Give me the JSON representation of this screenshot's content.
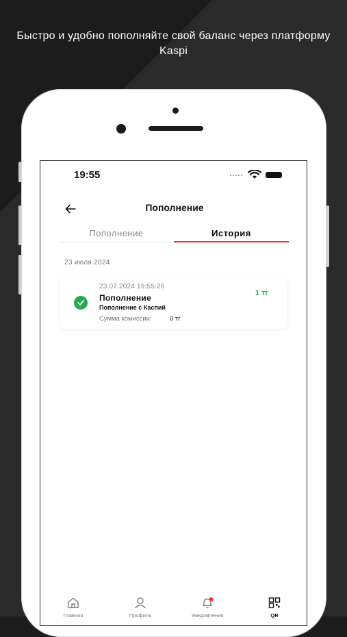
{
  "promo": {
    "text_line1": "Быстро и удобно пополняйте свой баланс через платформу",
    "text_line2": "Kaspi"
  },
  "status_bar": {
    "time": "19:55"
  },
  "header": {
    "back_icon": "arrow-left-icon",
    "title": "Пополнение"
  },
  "tabs": [
    {
      "label": "Пополнение",
      "active": false
    },
    {
      "label": "История",
      "active": true
    }
  ],
  "history": {
    "date_header": "23 июля 2024",
    "items": [
      {
        "datetime": "23.07.2024 19:55:26",
        "title": "Пополнение",
        "subtitle": "Пополнение с Каспий",
        "fee_label": "Сумма комиссии:",
        "fee_value": "0 тг",
        "amount": "1 тг",
        "status_icon": "check-circle-icon"
      }
    ]
  },
  "bottom_nav": [
    {
      "label": "Главная",
      "icon": "home-icon"
    },
    {
      "label": "Профиль",
      "icon": "user-icon"
    },
    {
      "label": "Уведомления",
      "icon": "bell-icon"
    },
    {
      "label": "QR",
      "icon": "qr-icon"
    }
  ],
  "colors": {
    "accent": "#e53935",
    "success": "#27a853",
    "background": "#1c1c1c"
  }
}
